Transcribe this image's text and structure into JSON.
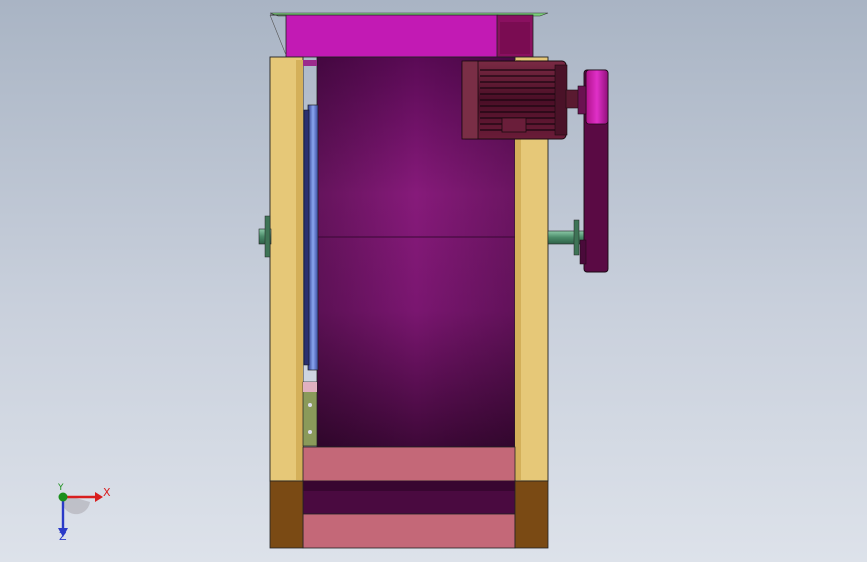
{
  "viewport": {
    "background_top": "#a9b4c4",
    "background_bottom": "#dde2ea"
  },
  "triad": {
    "x_label": "X",
    "y_label": "Y",
    "z_label": "Z",
    "x_color": "#d81e1e",
    "y_color": "#1c8f1c",
    "z_color": "#2a3ac8"
  },
  "model": {
    "colors": {
      "frame_post": "#e6c878",
      "drum": "#7a1670",
      "hood": "#c21ab4",
      "motor": "#5a1230",
      "pulley": "#8c1060",
      "shaft": "#5a9a78",
      "base_plate": "#c46878",
      "base_foot": "#7a4a14",
      "hub_disc": "#6a86d8"
    }
  }
}
